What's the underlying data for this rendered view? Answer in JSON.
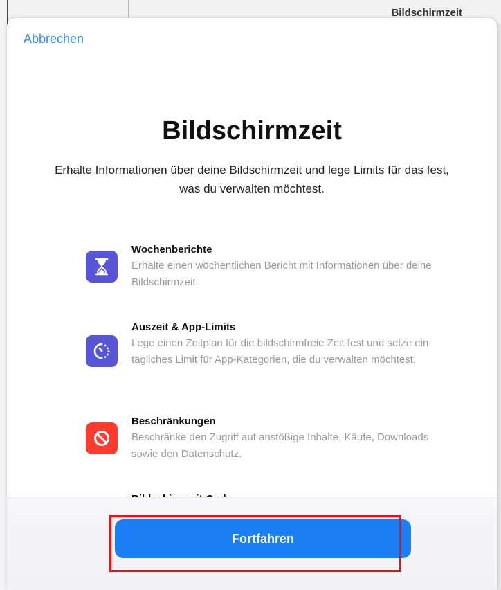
{
  "background": {
    "window_title": "Bildschirmzeit"
  },
  "sheet": {
    "cancel_label": "Abbrechen",
    "title": "Bildschirmzeit",
    "subtitle": "Erhalte Informationen über deine Bildschirmzeit und lege Limits für das fest, was du verwalten möchtest.",
    "features": [
      {
        "title": "Wochenberichte",
        "description": "Erhalte einen wöchentlichen Bericht mit Informationen über deine Bildschirmzeit.",
        "icon": "hourglass-icon",
        "color": "#5856d6"
      },
      {
        "title": "Auszeit & App-Limits",
        "description": "Lege einen Zeitplan für die bildschirmfreie Zeit fest und setze ein tägliches Limit für App-Kategorien, die du verwalten möchtest.",
        "icon": "timer-icon",
        "color": "#5856d6"
      },
      {
        "title": "Beschränkungen",
        "description": "Beschränke den Zugriff auf anstößige Inhalte, Käufe, Downloads sowie den Datenschutz.",
        "icon": "restriction-icon",
        "color": "#ff3b30"
      }
    ],
    "partial_feature_title": "Bildschirmzeit-Code",
    "continue_label": "Fortfahren"
  },
  "colors": {
    "accent": "#1a7ff5",
    "highlight": "#e11111"
  }
}
